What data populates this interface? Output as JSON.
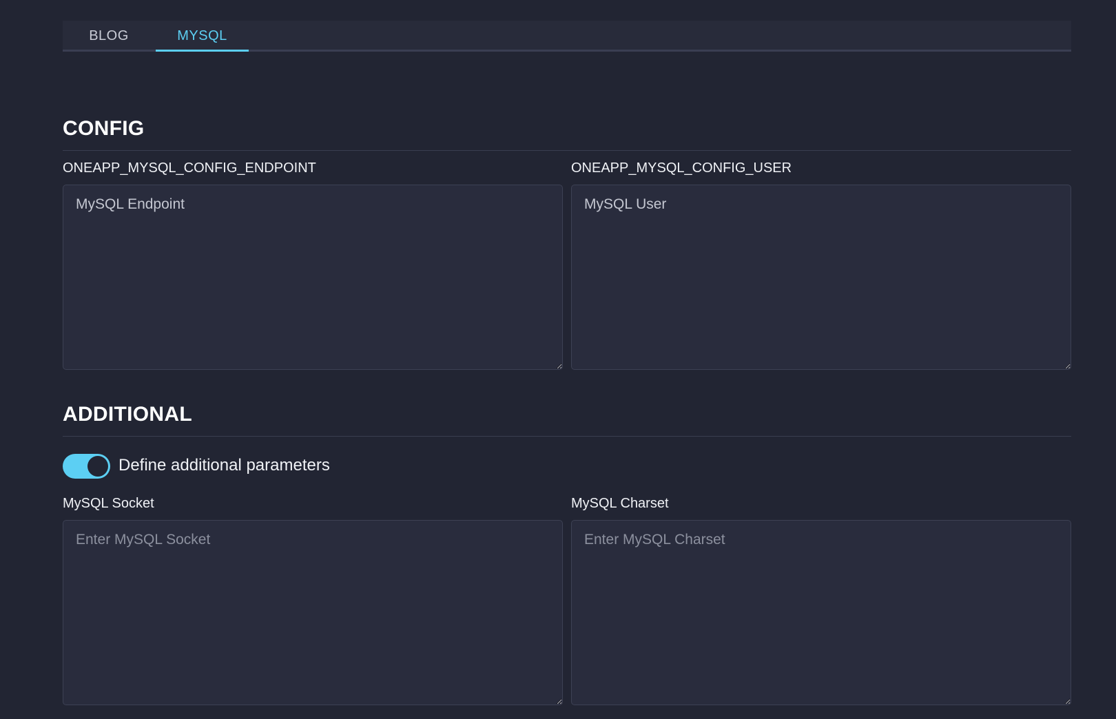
{
  "tabs": [
    {
      "label": "BLOG",
      "active": false
    },
    {
      "label": "MYSQL",
      "active": true
    }
  ],
  "config": {
    "title": "CONFIG",
    "endpoint": {
      "label": "ONEAPP_MYSQL_CONFIG_ENDPOINT",
      "placeholder": "MySQL Endpoint"
    },
    "user": {
      "label": "ONEAPP_MYSQL_CONFIG_USER",
      "placeholder": "MySQL User"
    }
  },
  "additional": {
    "title": "ADDITIONAL",
    "toggle": {
      "label": "Define additional parameters",
      "checked": true
    },
    "socket": {
      "label": "MySQL Socket",
      "placeholder": "Enter MySQL Socket"
    },
    "charset": {
      "label": "MySQL Charset",
      "placeholder": "Enter MySQL Charset"
    }
  },
  "colors": {
    "background": "#222533",
    "accent": "#5ccff3",
    "field_background": "#292c3d"
  }
}
